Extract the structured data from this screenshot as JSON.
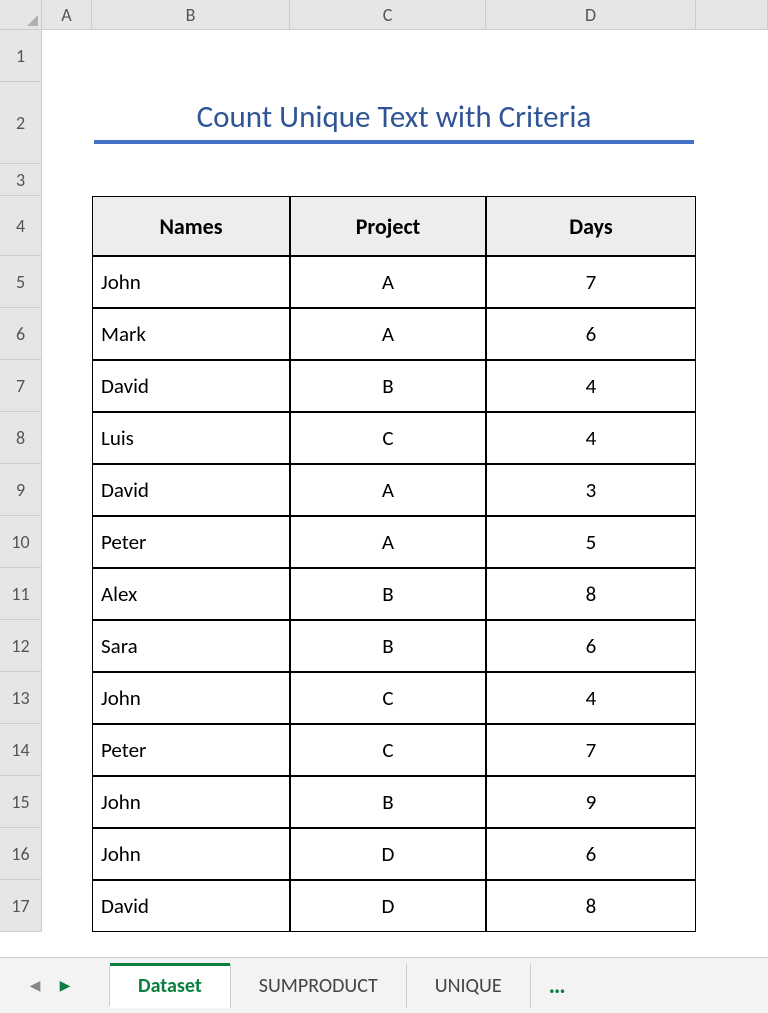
{
  "columns": [
    "A",
    "B",
    "C",
    "D"
  ],
  "rows": [
    "1",
    "2",
    "3",
    "4",
    "5",
    "6",
    "7",
    "8",
    "9",
    "10",
    "11",
    "12",
    "13",
    "14",
    "15",
    "16",
    "17"
  ],
  "title": "Count Unique Text with Criteria",
  "headers": {
    "names": "Names",
    "project": "Project",
    "days": "Days"
  },
  "data": [
    {
      "name": "John",
      "project": "A",
      "days": "7"
    },
    {
      "name": "Mark",
      "project": "A",
      "days": "6"
    },
    {
      "name": "David",
      "project": "B",
      "days": "4"
    },
    {
      "name": "Luis",
      "project": "C",
      "days": "4"
    },
    {
      "name": "David",
      "project": "A",
      "days": "3"
    },
    {
      "name": "Peter",
      "project": "A",
      "days": "5"
    },
    {
      "name": "Alex",
      "project": "B",
      "days": "8"
    },
    {
      "name": "Sara",
      "project": "B",
      "days": "6"
    },
    {
      "name": "John",
      "project": "C",
      "days": "4"
    },
    {
      "name": "Peter",
      "project": "C",
      "days": "7"
    },
    {
      "name": "John",
      "project": "B",
      "days": "9"
    },
    {
      "name": "John",
      "project": "D",
      "days": "6"
    },
    {
      "name": "David",
      "project": "D",
      "days": "8"
    }
  ],
  "tabs": {
    "active": "Dataset",
    "others": [
      "SUMPRODUCT",
      "UNIQUE"
    ]
  },
  "more": "…"
}
